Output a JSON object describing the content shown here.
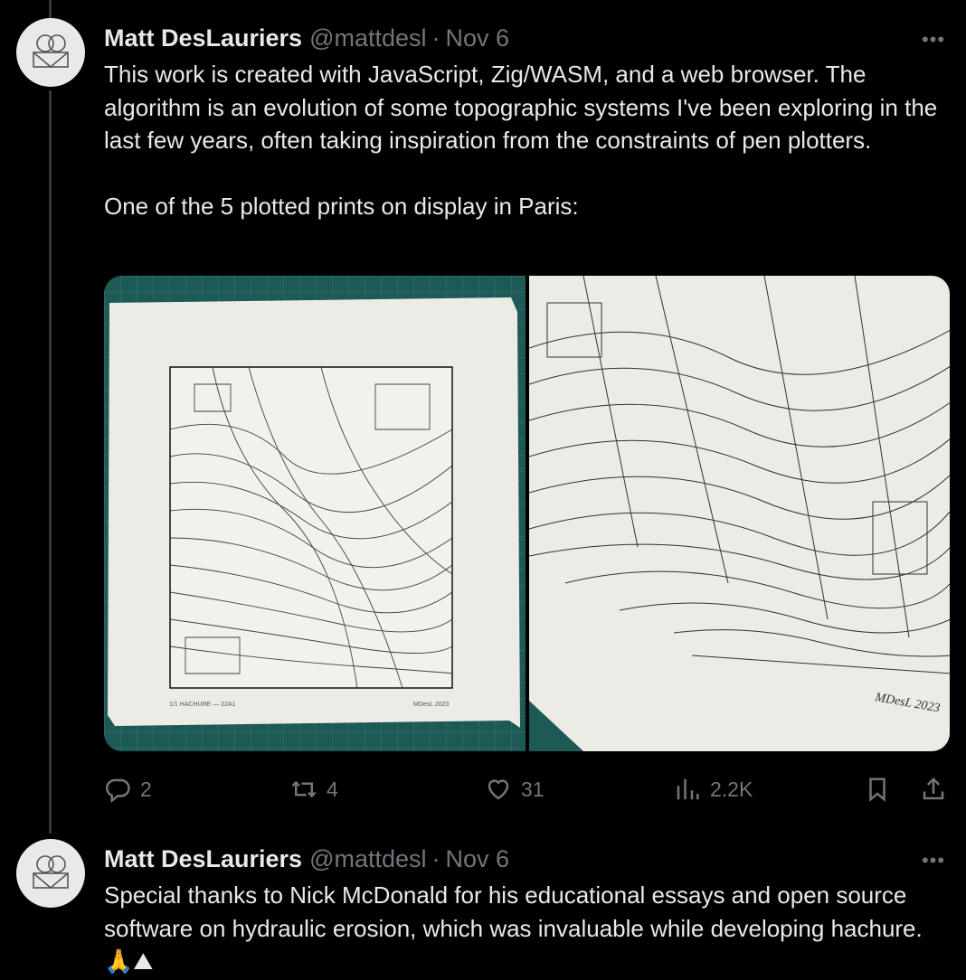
{
  "tweets": [
    {
      "name": "Matt DesLauriers",
      "handle": "@mattdesl",
      "separator": "·",
      "date": "Nov 6",
      "more": "•••",
      "text": "This work is created with JavaScript, Zig/WASM, and a web browser. The algorithm is an evolution of some topographic systems I've been exploring in the last few years, often taking inspiration from the constraints of pen plotters.\n\nOne of the 5 plotted prints on display in Paris:",
      "media": {
        "left_caption": "1/1 HACHURE — 22A1",
        "left_signature": "MDesL 2023",
        "right_signature": "MDesL 2023"
      },
      "actions": {
        "replies": "2",
        "retweets": "4",
        "likes": "31",
        "views": "2.2K"
      }
    },
    {
      "name": "Matt DesLauriers",
      "handle": "@mattdesl",
      "separator": "·",
      "date": "Nov 6",
      "more": "•••",
      "text": "Special thanks to Nick McDonald for his educational essays and open source software on hydraulic erosion, which was invaluable while developing hachure. 🙏⛰"
    }
  ],
  "icons": {
    "reply": "reply-icon",
    "retweet": "retweet-icon",
    "like": "heart-icon",
    "views": "views-icon",
    "bookmark": "bookmark-icon",
    "share": "share-icon"
  },
  "colors": {
    "background": "#000000",
    "text": "#e7e9ea",
    "muted": "#71767b",
    "mat": "#1d5a56",
    "paper": "#ecebe6"
  }
}
